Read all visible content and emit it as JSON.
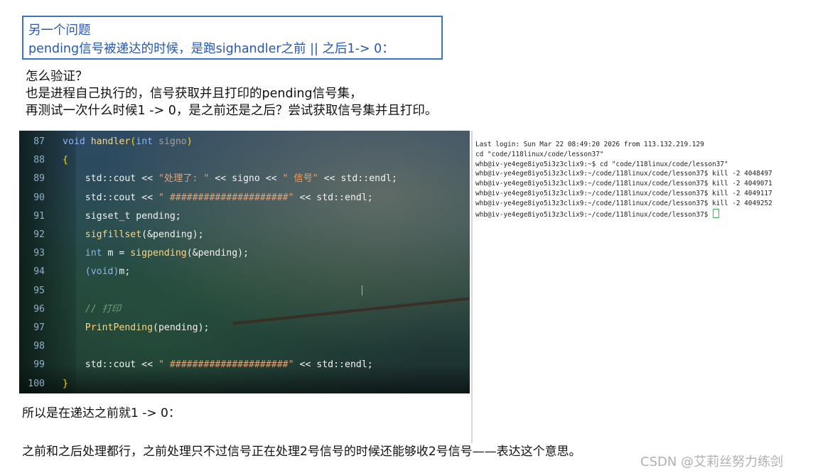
{
  "title_box": {
    "line1": "另一个问题",
    "line2": "pending信号被递达的时候，是跑sighandler之前 || 之后1-> 0："
  },
  "intro": [
    "怎么验证？",
    "也是进程自己执行的，信号获取并且打印的pending信号集，",
    "再测试一次什么时候1 -> 0，是之前还是之后？尝试获取信号集并且打印。"
  ],
  "code": {
    "lines": [
      {
        "num": "87",
        "parts": [
          {
            "t": "void",
            "c": "kw"
          },
          {
            "t": " "
          },
          {
            "t": "handler",
            "c": "fn"
          },
          {
            "t": "(",
            "c": "br"
          },
          {
            "t": "int",
            "c": "kw"
          },
          {
            "t": " signo",
            "c": "pa"
          },
          {
            "t": ")",
            "c": "br"
          }
        ]
      },
      {
        "num": "88",
        "parts": [
          {
            "t": "{",
            "c": "br"
          }
        ]
      },
      {
        "num": "89",
        "parts": [
          {
            "t": "    std::cout << "
          },
          {
            "t": "\"处理了: \"",
            "c": "str"
          },
          {
            "t": " << signo << "
          },
          {
            "t": "\" 信号\"",
            "c": "str"
          },
          {
            "t": " << std::endl;"
          }
        ]
      },
      {
        "num": "90",
        "parts": [
          {
            "t": "    std::cout << "
          },
          {
            "t": "\" #####################\"",
            "c": "str"
          },
          {
            "t": " << std::endl;"
          }
        ]
      },
      {
        "num": "91",
        "parts": [
          {
            "t": "    sigset_t pending;"
          }
        ]
      },
      {
        "num": "92",
        "parts": [
          {
            "t": "    "
          },
          {
            "t": "sigfillset",
            "c": "fn"
          },
          {
            "t": "(&pending);"
          }
        ]
      },
      {
        "num": "93",
        "parts": [
          {
            "t": "    "
          },
          {
            "t": "int",
            "c": "kw"
          },
          {
            "t": " m = "
          },
          {
            "t": "sigpending",
            "c": "fn"
          },
          {
            "t": "(&pending);"
          }
        ]
      },
      {
        "num": "94",
        "parts": [
          {
            "t": "    "
          },
          {
            "t": "(void)",
            "c": "kw"
          },
          {
            "t": "m;"
          }
        ]
      },
      {
        "num": "95",
        "parts": []
      },
      {
        "num": "96",
        "parts": [
          {
            "t": "    "
          },
          {
            "t": "// 打印",
            "c": "cm"
          }
        ]
      },
      {
        "num": "97",
        "parts": [
          {
            "t": "    "
          },
          {
            "t": "PrintPending",
            "c": "fn"
          },
          {
            "t": "(pending);"
          }
        ]
      },
      {
        "num": "98",
        "parts": []
      },
      {
        "num": "99",
        "parts": [
          {
            "t": "    std::cout << "
          },
          {
            "t": "\" #####################\"",
            "c": "str"
          },
          {
            "t": " << std::endl;"
          }
        ]
      },
      {
        "num": "100",
        "parts": [
          {
            "t": "}",
            "c": "br"
          }
        ]
      }
    ],
    "colors": {
      "kw": "#8ab4f8",
      "fn": "#ffd479",
      "str": "#e8a070",
      "cm": "#6ea06e",
      "br": "#ffd700",
      "pa": "#a0a0a0"
    }
  },
  "terminal": {
    "lines": [
      "Last login: Sun Mar 22 08:49:20 2026 from 113.132.219.129",
      "cd \"code/118linux/code/lesson37\"",
      "whb@iv-ye4ege8iyo5i3z3clix9:~$ cd \"code/118linux/code/lesson37\"",
      "whb@iv-ye4ege8iyo5i3z3clix9:~/code/118linux/code/lesson37$ kill -2 4048497",
      "whb@iv-ye4ege8iyo5i3z3clix9:~/code/118linux/code/lesson37$ kill -2 4049071",
      "whb@iv-ye4ege8iyo5i3z3clix9:~/code/118linux/code/lesson37$ kill -2 4049117",
      "whb@iv-ye4ege8iyo5i3z3clix9:~/code/118linux/code/lesson37$ kill -2 4049252",
      "whb@iv-ye4ege8iyo5i3z3clix9:~/code/118linux/code/lesson37$ "
    ]
  },
  "after": {
    "line1": "所以是在递达之前就1 -> 0：",
    "line2": "之前和之后处理都行，之前处理只不过信号正在处理2号信号的时候还能够收2号信号——表达这个意思。"
  },
  "watermark": "CSDN @艾莉丝努力练剑"
}
